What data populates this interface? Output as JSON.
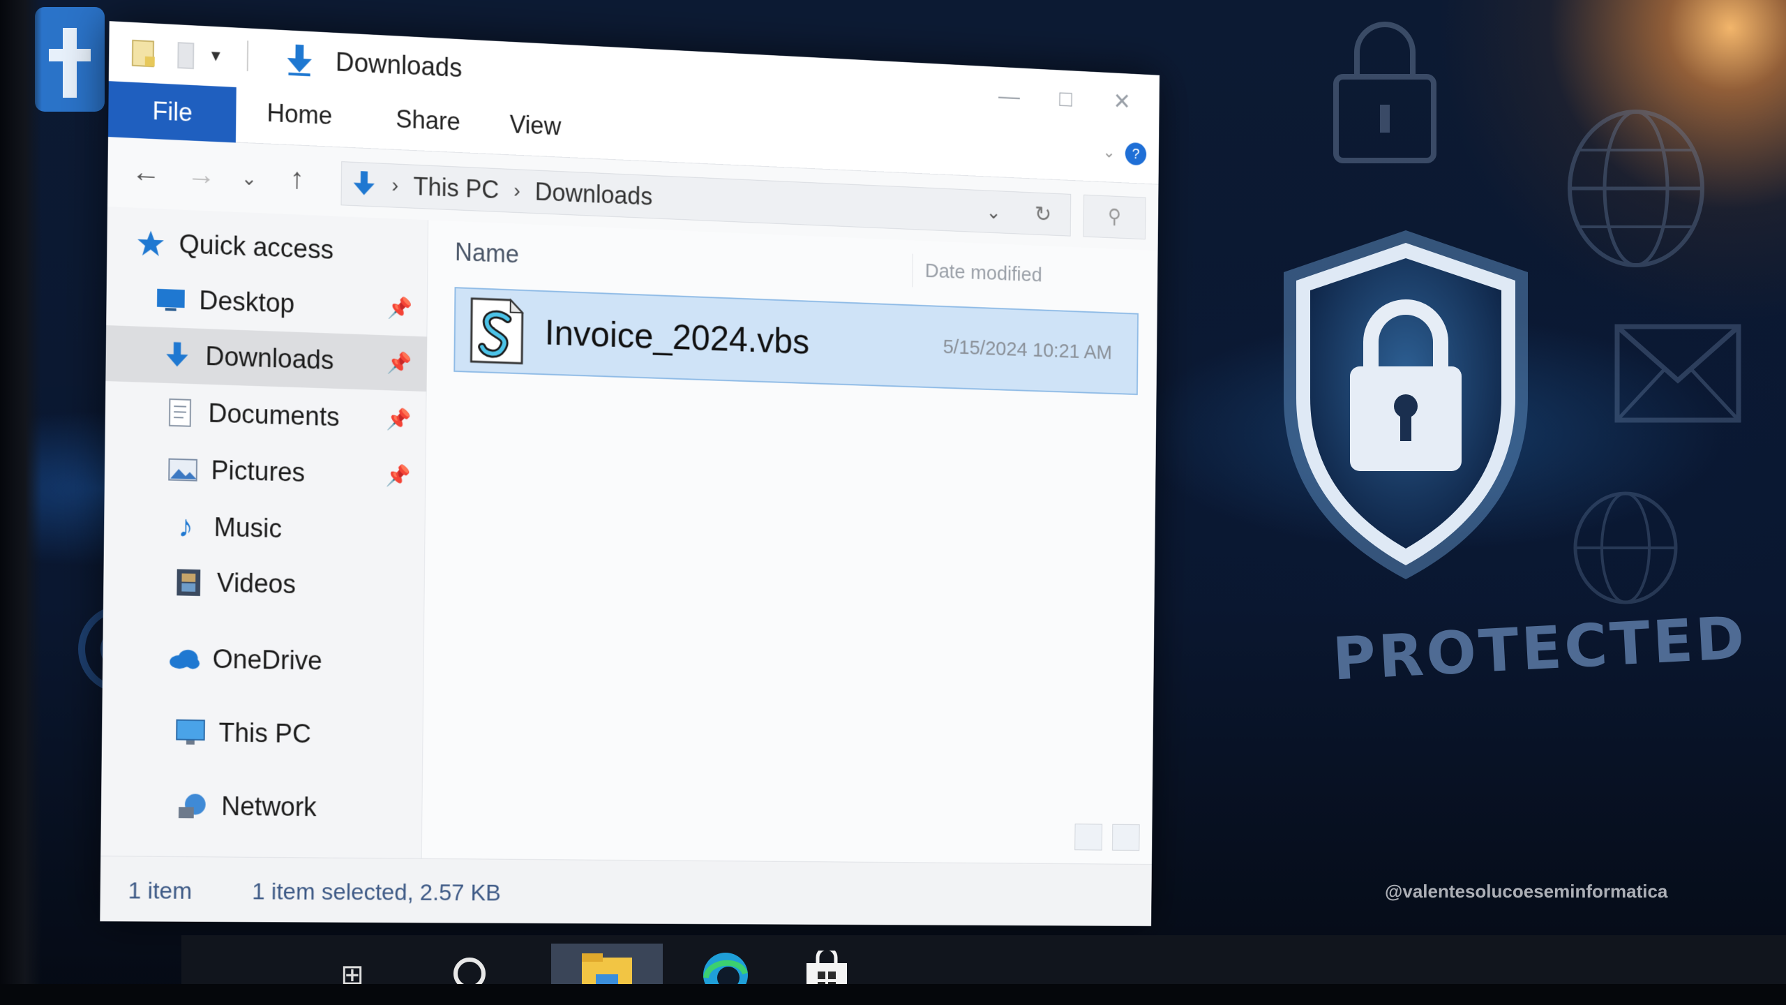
{
  "window": {
    "title": "Downloads",
    "controls": [
      "minimize",
      "maximize",
      "close"
    ]
  },
  "ribbon": {
    "tabs": [
      {
        "label": "File",
        "active": true
      },
      {
        "label": "Home"
      },
      {
        "label": "Share"
      },
      {
        "label": "View"
      }
    ],
    "accent": "#1f5fbf"
  },
  "navbar": {
    "breadcrumb": [
      "This PC",
      "Downloads"
    ]
  },
  "nav_pane": {
    "items": [
      {
        "label": "Quick access",
        "icon": "star-icon"
      },
      {
        "label": "Desktop",
        "icon": "desktop-icon",
        "pinned": true
      },
      {
        "label": "Downloads",
        "icon": "download-arrow-icon",
        "pinned": true,
        "selected": true
      },
      {
        "label": "Documents",
        "icon": "document-icon",
        "pinned": true
      },
      {
        "label": "Pictures",
        "icon": "picture-icon",
        "pinned": true
      },
      {
        "label": "Music",
        "icon": "music-note-icon"
      },
      {
        "label": "Videos",
        "icon": "film-icon"
      },
      {
        "label": "OneDrive",
        "icon": "cloud-icon"
      },
      {
        "label": "This PC",
        "icon": "monitor-icon"
      },
      {
        "label": "Network",
        "icon": "network-icon"
      }
    ]
  },
  "file_list": {
    "columns": [
      "Name",
      "Date modified"
    ],
    "rows": [
      {
        "name": "Invoice_2024.vbs",
        "date_modified": "5/15/2024 10:21 AM",
        "icon": "vbscript-file-icon",
        "selected": true
      }
    ]
  },
  "status": {
    "count": "1 item",
    "selection": "1 item selected, 2.57 KB"
  },
  "taskbar": {
    "items": [
      "start-icon",
      "search-icon",
      "file-explorer-icon",
      "edge-icon",
      "store-icon"
    ]
  },
  "wallpaper": {
    "text": "PROTECTED",
    "watermark": "@valentesolucoeseminformatica"
  }
}
